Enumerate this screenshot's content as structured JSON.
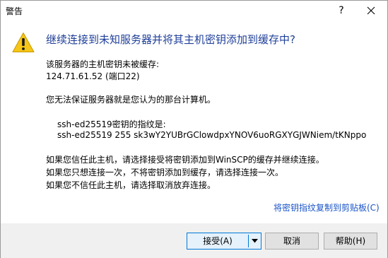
{
  "window": {
    "title": "警告",
    "help_glyph": "?"
  },
  "message": {
    "heading": "继续连接到未知服务器并将其主机密钥添加到缓存中?",
    "not_cached": "该服务器的主机密钥未被缓存:",
    "host": "124.71.61.52 (端口22)",
    "cannot_verify": "您无法保证服务器就是您认为的那台计算机。",
    "fingerprint_label": "ssh-ed25519密钥的指纹是:",
    "fingerprint_value": "ssh-ed25519 255 sk3wY2YUBrGClowdpxYNOV6uoRGXYGJWNiem/tKNppo",
    "trust_line": "如果您信任此主机，请选择接受将密钥添加到WinSCP的缓存并继续连接。",
    "once_line": "如果您只想连接一次，不将密钥添加到缓存，请选择连接一次。",
    "distrust_line": "如果您不信任此主机，请选择取消放弃连接。"
  },
  "copy_link": "将密钥指纹复制到剪贴板(C)",
  "buttons": {
    "accept": "接受(A)",
    "cancel": "取消",
    "help": "帮助(H)"
  },
  "icons": {
    "warning": "warning-icon",
    "close": "close-icon",
    "dropdown": "chevron-down-icon"
  },
  "colors": {
    "heading": "#1f3f99",
    "link": "#1a54c8",
    "warning": "#f5c518",
    "accent": "#0078d7"
  }
}
